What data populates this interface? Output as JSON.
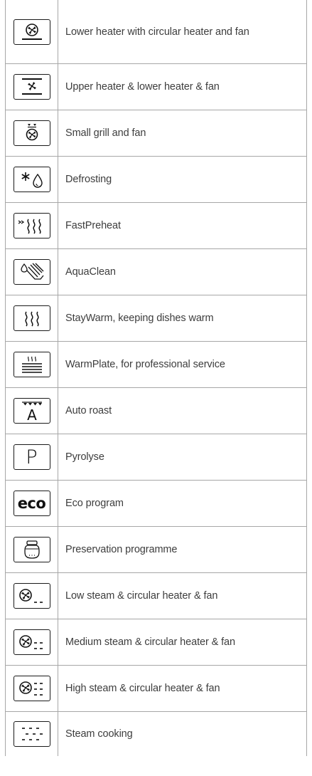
{
  "legend": {
    "rows": [
      {
        "icon": "lower-heater-circular-fan-icon",
        "label": "Lower heater with circular heater and fan"
      },
      {
        "icon": "upper-lower-heater-fan-icon",
        "label": "Upper heater & lower heater & fan"
      },
      {
        "icon": "small-grill-fan-icon",
        "label": "Small grill and fan"
      },
      {
        "icon": "defrosting-icon",
        "label": "Defrosting"
      },
      {
        "icon": "fast-preheat-icon",
        "label": "FastPreheat"
      },
      {
        "icon": "aqua-clean-icon",
        "label": "AquaClean"
      },
      {
        "icon": "stay-warm-icon",
        "label": "StayWarm, keeping dishes warm"
      },
      {
        "icon": "warm-plate-icon",
        "label": "WarmPlate, for professional service"
      },
      {
        "icon": "auto-roast-icon",
        "label": "Auto roast",
        "glyph": "A"
      },
      {
        "icon": "pyrolyse-icon",
        "label": "Pyrolyse",
        "glyph": "P"
      },
      {
        "icon": "eco-program-icon",
        "label": "Eco program",
        "glyph": "eco"
      },
      {
        "icon": "preservation-icon",
        "label": "Preservation programme"
      },
      {
        "icon": "low-steam-fan-icon",
        "label": "Low steam & circular heater & fan"
      },
      {
        "icon": "medium-steam-fan-icon",
        "label": "Medium steam & circular heater & fan"
      },
      {
        "icon": "high-steam-fan-icon",
        "label": "High steam & circular heater & fan"
      },
      {
        "icon": "steam-cooking-icon",
        "label": "Steam cooking"
      }
    ]
  }
}
